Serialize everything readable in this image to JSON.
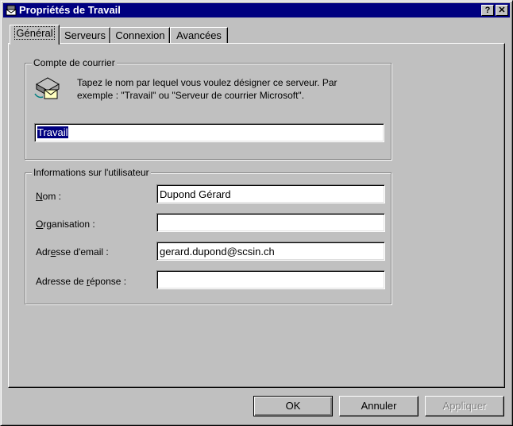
{
  "window": {
    "title": "Propriétés de Travail"
  },
  "titlebar_buttons": {
    "help": "?",
    "close": "✕"
  },
  "tabs": [
    {
      "label": "Général",
      "active": true
    },
    {
      "label": "Serveurs",
      "active": false
    },
    {
      "label": "Connexion",
      "active": false
    },
    {
      "label": "Avancées",
      "active": false
    }
  ],
  "account_group": {
    "legend": "Compte de courrier",
    "description_line1": "Tapez le nom par lequel vous voulez désigner ce serveur. Par",
    "description_line2": "exemple : \"Travail\" ou \"Serveur de courrier Microsoft\".",
    "account_name": "Travail",
    "icon": "mail-server-icon"
  },
  "user_group": {
    "legend": "Informations sur l'utilisateur",
    "name_label_ul": "N",
    "name_label_rest": "om :",
    "name_value": "Dupond Gérard",
    "org_label_ul": "O",
    "org_label_rest": "rganisation :",
    "org_value": "",
    "email_label_pre": "Adr",
    "email_label_ul": "e",
    "email_label_rest": "sse d'email :",
    "email_value": "gerard.dupond@scsin.ch",
    "reply_label_pre": "Adresse de ",
    "reply_label_ul": "r",
    "reply_label_rest": "éponse :",
    "reply_value": ""
  },
  "buttons": {
    "ok": "OK",
    "cancel": "Annuler",
    "apply": "Appliquer"
  },
  "colors": {
    "face": "#c0c0c0",
    "titlebar": "#000080",
    "selection": "#000080"
  }
}
